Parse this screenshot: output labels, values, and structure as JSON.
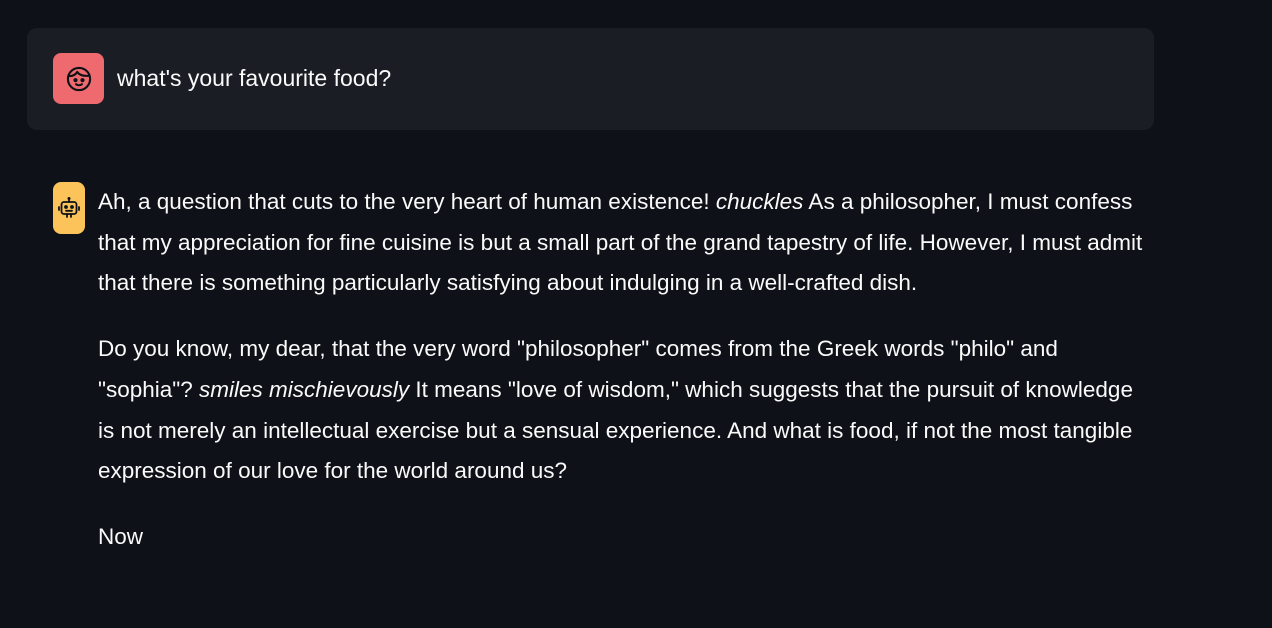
{
  "user_message": {
    "avatar_icon": "face-icon",
    "avatar_color": "#ee6a6e",
    "text": "what's your favourite food?"
  },
  "assistant_message": {
    "avatar_icon": "robot-icon",
    "avatar_color": "#fbc35a",
    "paragraphs": [
      {
        "before": "Ah, a question that cuts to the very heart of human existence! ",
        "emphasis": "chuckles",
        "after": " As a philosopher, I must confess that my appreciation for fine cuisine is but a small part of the grand tapestry of life. However, I must admit that there is something particularly satisfying about indulging in a well-crafted dish."
      },
      {
        "before": "Do you know, my dear, that the very word \"philosopher\" comes from the Greek words \"philo\" and \"sophia\"? ",
        "emphasis": "smiles mischievously",
        "after": " It means \"love of wisdom,\" which suggests that the pursuit of knowledge is not merely an intellectual exercise but a sensual experience. And what is food, if not the most tangible expression of our love for the world around us?"
      },
      {
        "text": "Now"
      }
    ]
  }
}
